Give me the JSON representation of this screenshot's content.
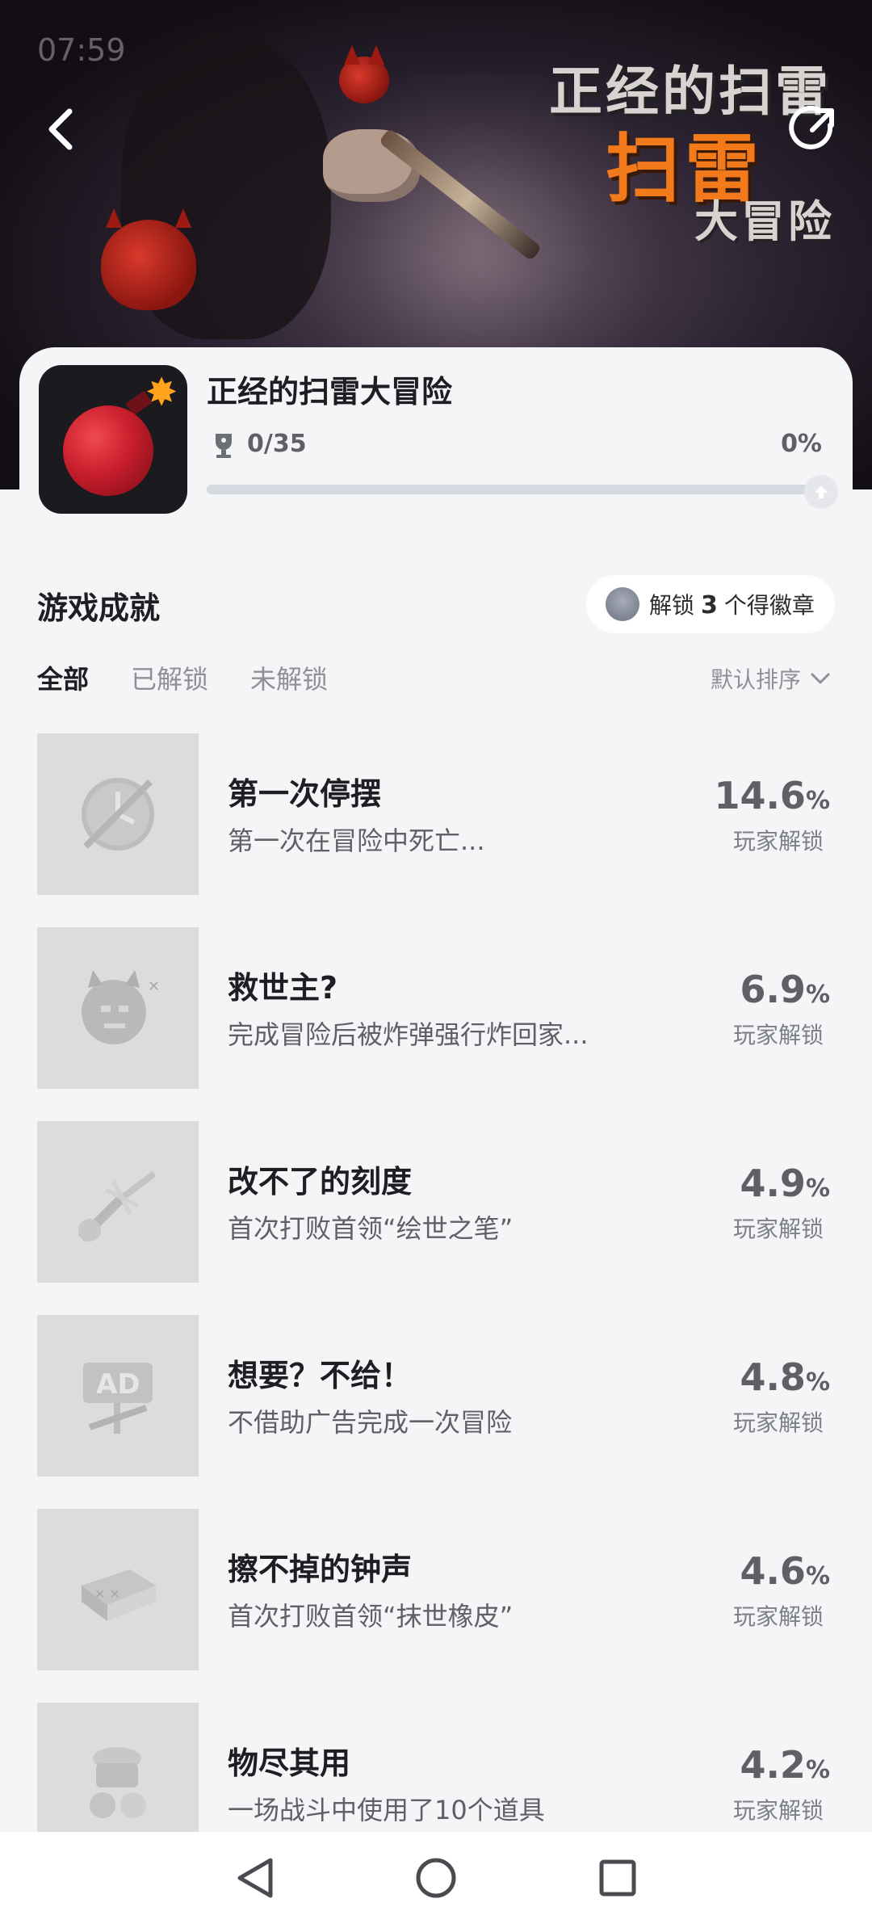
{
  "status_bar": {
    "time": "07:59"
  },
  "banner": {
    "title_line1": "正经的扫雷",
    "title_line2": "扫雷",
    "title_line3": "大冒险"
  },
  "game": {
    "name": "正经的扫雷大冒险",
    "achievements_unlocked": "0/35",
    "progress_percent_label": "0%",
    "progress_fraction": 0
  },
  "section": {
    "title": "游戏成就",
    "badge_prefix": "解锁",
    "badge_count": "3",
    "badge_suffix": "个得徽章"
  },
  "tabs": [
    {
      "label": "全部",
      "active": true
    },
    {
      "label": "已解锁",
      "active": false
    },
    {
      "label": "未解锁",
      "active": false
    }
  ],
  "sort": {
    "label": "默认排序"
  },
  "achievements": [
    {
      "title": "第一次停摆",
      "desc": "第一次在冒险中死亡...",
      "pct": "14.6",
      "unit": "%",
      "sub": "玩家解锁",
      "icon": "broken-clock-icon"
    },
    {
      "title": "救世主?",
      "desc": "完成冒险后被炸弹强行炸回家...",
      "pct": "6.9",
      "unit": "%",
      "sub": "玩家解锁",
      "icon": "demon-bomb-icon"
    },
    {
      "title": "改不了的刻度",
      "desc": "首次打败首领“绘世之笔”",
      "pct": "4.9",
      "unit": "%",
      "sub": "玩家解锁",
      "icon": "broken-brush-icon"
    },
    {
      "title": "想要？不给！",
      "desc": "不借助广告完成一次冒险",
      "pct": "4.8",
      "unit": "%",
      "sub": "玩家解锁",
      "icon": "ad-sign-icon"
    },
    {
      "title": "擦不掉的钟声",
      "desc": "首次打败首领“抹世橡皮”",
      "pct": "4.6",
      "unit": "%",
      "sub": "玩家解锁",
      "icon": "eraser-icon"
    },
    {
      "title": "物尽其用",
      "desc": "一场战斗中使用了10个道具",
      "pct": "4.2",
      "unit": "%",
      "sub": "玩家解锁",
      "icon": "item-pile-icon"
    }
  ],
  "colors": {
    "background": "#f4f5f7",
    "text_primary": "#1d1e22",
    "text_secondary": "#5e6066",
    "accent_orange": "#f27a1b",
    "bomb_red": "#c81e2d"
  }
}
